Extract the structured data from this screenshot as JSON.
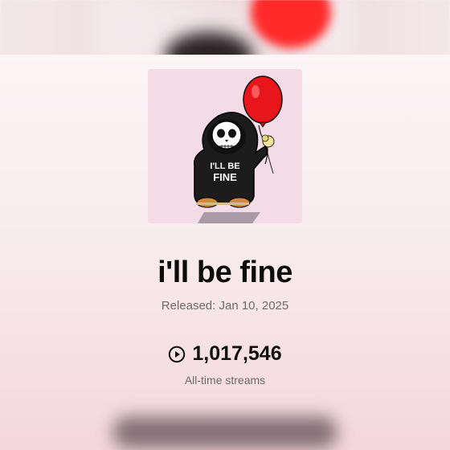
{
  "release": {
    "title": "i'll be fine",
    "released": "Released: Jan 10, 2025",
    "streams_count": "1,017,546",
    "streams_label": "All-time streams",
    "cover_text_line1": "I'LL BE",
    "cover_text_line2": "FINE"
  },
  "colors": {
    "balloon": "#e8151a",
    "hoodie": "#1c1c1c",
    "cover_bg": "#f3dce6"
  },
  "icons": {
    "streams": "play-circle-icon"
  }
}
